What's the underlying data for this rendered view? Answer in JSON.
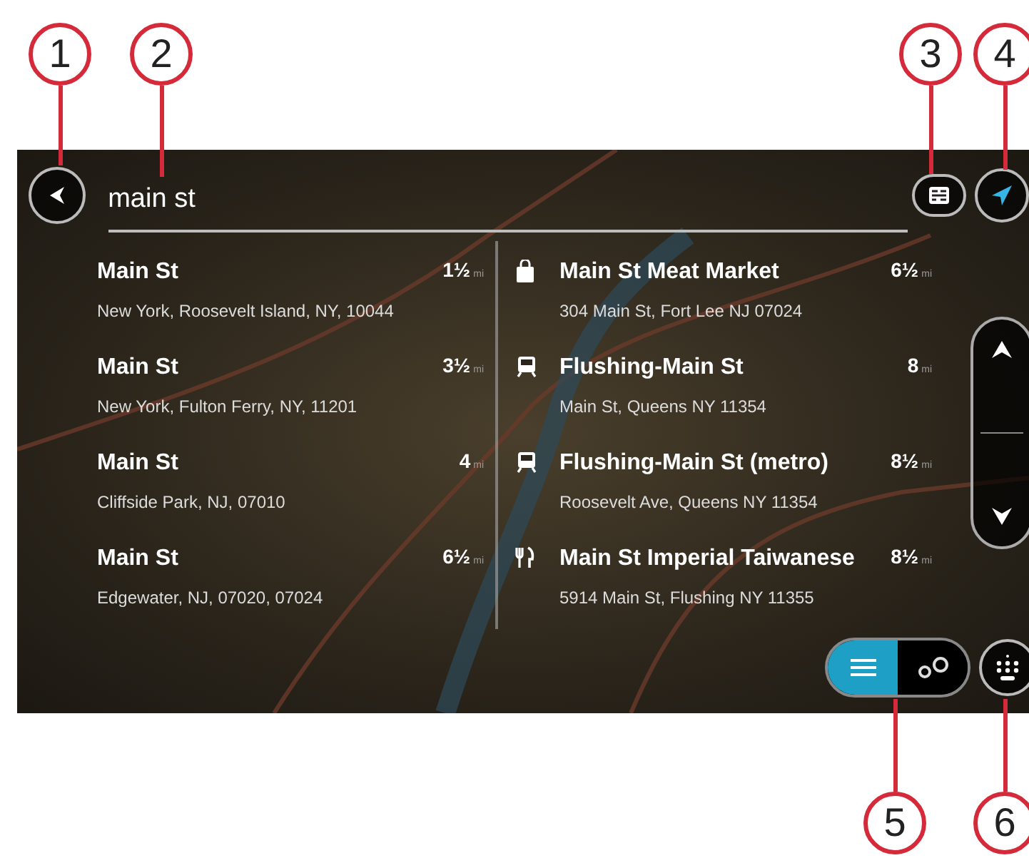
{
  "search": {
    "value": "main st"
  },
  "results_left": [
    {
      "name": "Main St",
      "address": "New York, Roosevelt Island, NY, 10044",
      "distance": "1½",
      "unit": "mi"
    },
    {
      "name": "Main St",
      "address": "New York, Fulton Ferry, NY, 11201",
      "distance": "3½",
      "unit": "mi"
    },
    {
      "name": "Main St",
      "address": "Cliffside Park, NJ, 07010",
      "distance": "4",
      "unit": "mi"
    },
    {
      "name": "Main St",
      "address": "Edgewater, NJ, 07020, 07024",
      "distance": "6½",
      "unit": "mi"
    }
  ],
  "results_right": [
    {
      "kind": "shop",
      "name": "Main St Meat Market",
      "address": "304 Main St, Fort Lee NJ 07024",
      "distance": "6½",
      "unit": "mi"
    },
    {
      "kind": "train",
      "name": "Flushing-Main St",
      "address": "Main St, Queens NY 11354",
      "distance": "8",
      "unit": "mi"
    },
    {
      "kind": "train",
      "name": "Flushing-Main St (metro)",
      "address": "Roosevelt Ave, Queens NY 11354",
      "distance": "8½",
      "unit": "mi"
    },
    {
      "kind": "restaurant",
      "name": "Main St Imperial Taiwanese",
      "address": "5914 Main St, Flushing NY 11355",
      "distance": "8½",
      "unit": "mi"
    }
  ],
  "view_toggle": [
    {
      "kind": "list",
      "selected": true
    },
    {
      "kind": "map",
      "selected": false
    }
  ],
  "callouts": [
    {
      "label": "1"
    },
    {
      "label": "2"
    },
    {
      "label": "3"
    },
    {
      "label": "4"
    },
    {
      "label": "5"
    },
    {
      "label": "6"
    }
  ]
}
